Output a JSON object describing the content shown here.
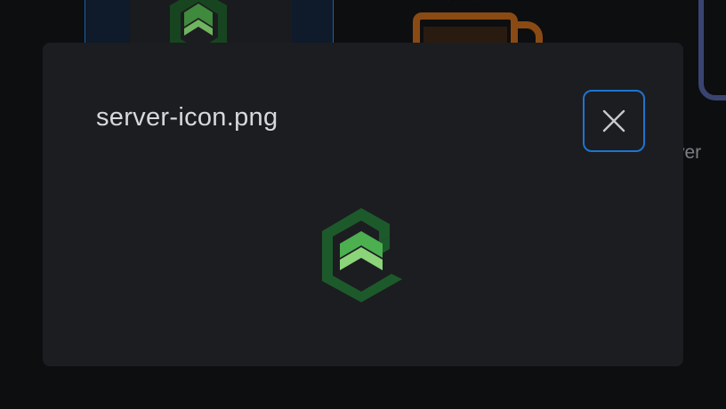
{
  "modal": {
    "title": "server-icon.png"
  },
  "background": {
    "partial_file_label": "rver"
  },
  "icons": {
    "close": "close-icon",
    "preview": "server-logo-image",
    "bg_server": "server-logo-image",
    "bg_mug": "coffee-mug-icon",
    "bg_generic": "file-icon"
  },
  "colors": {
    "accent": "#1e74d0",
    "modal_bg": "#1c1d21",
    "logo_dark_green": "#1d5a2b",
    "logo_mid_green": "#4caf50",
    "logo_light_green": "#8bd47a"
  }
}
